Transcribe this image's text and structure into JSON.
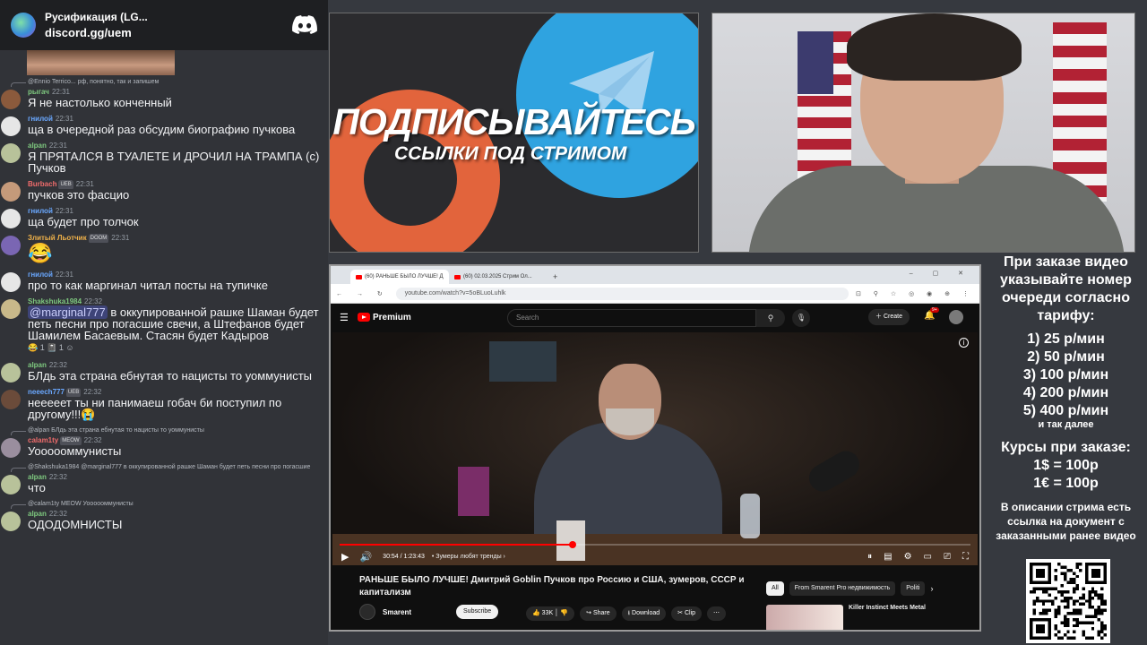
{
  "discord": {
    "server_name": "Русификация (LG...",
    "invite": "discord.gg/uem"
  },
  "chat": [
    {
      "type": "reply",
      "text": "@Ennio Terrico... рф, понятно, так и запишем"
    },
    {
      "type": "msg",
      "name": "рыгач",
      "name_color": "#7ec87f",
      "badge": "",
      "time": "22:31",
      "body": "Я не настолько конченный",
      "avatar_color": "#8b5a3c"
    },
    {
      "type": "msg",
      "name": "гнилой",
      "name_color": "#6aa8ff",
      "badge": "",
      "time": "22:31",
      "body": "ща в очередной раз обсудим биографию пучкова",
      "avatar_color": "#e6e6e6"
    },
    {
      "type": "msg",
      "name": "alpan",
      "name_color": "#7ec87f",
      "badge": "",
      "time": "22:31",
      "body": "Я ПРЯТАЛСЯ В ТУАЛЕТЕ И ДРОЧИЛ НА ТРАМПА (с) Пучков",
      "avatar_color": "#b8c29a"
    },
    {
      "type": "msg",
      "name": "Burbach",
      "name_color": "#f06c6c",
      "badge": "UEB",
      "time": "22:31",
      "body": "пучков это фасцио",
      "avatar_color": "#c59a7a"
    },
    {
      "type": "msg",
      "name": "гнилой",
      "name_color": "#6aa8ff",
      "badge": "",
      "time": "22:31",
      "body": "ща будет про толчок",
      "avatar_color": "#e6e6e6"
    },
    {
      "type": "msg",
      "name": "Злитый Льотчик",
      "name_color": "#f0b24a",
      "badge": "DOOM",
      "time": "22:31",
      "body": "😂",
      "avatar_color": "#7a66b3"
    },
    {
      "type": "msg",
      "name": "гнилой",
      "name_color": "#6aa8ff",
      "badge": "",
      "time": "22:31",
      "body": "про то как маргинал читал посты на тупичке",
      "avatar_color": "#e6e6e6"
    },
    {
      "type": "msg",
      "name": "Shakshuka1984",
      "name_color": "#7ec87f",
      "badge": "",
      "time": "22:32",
      "mention": "@marginal777",
      "body": " в оккупированной рашке Шаман будет петь песни про погасшие свечи, а Штефанов будет Шамилем Басаевым. Стасян будет Кадыров",
      "reactions": "😂 1   📓 1   ☺",
      "avatar_color": "#c9b98a"
    },
    {
      "type": "msg",
      "name": "alpan",
      "name_color": "#7ec87f",
      "badge": "",
      "time": "22:32",
      "body": "БЛдь эта страна ебнутая то нацисты то уоммунисты",
      "avatar_color": "#b8c29a"
    },
    {
      "type": "msg",
      "name": "neeech777",
      "name_color": "#6aa8ff",
      "badge": "UEB",
      "time": "22:32",
      "body": "нееееет ты ни панимаеш гобач би поступил по другому!!!😭",
      "avatar_color": "#6b4b3a"
    },
    {
      "type": "reply",
      "text": "@alpan БЛдь эта страна ебнутая то нацисты то уоммунисты"
    },
    {
      "type": "msg",
      "name": "calam1ty",
      "name_color": "#f06c6c",
      "badge": "MEOW",
      "time": "22:32",
      "body": "Уоооооммунисты",
      "avatar_color": "#9a8e9e"
    },
    {
      "type": "reply",
      "text": "@Shakshuka1984 @marginal777 в оккупированной рашке Шаман будет петь песни про погасшие"
    },
    {
      "type": "msg",
      "name": "alpan",
      "name_color": "#7ec87f",
      "badge": "",
      "time": "22:32",
      "body": "что",
      "avatar_color": "#b8c29a"
    },
    {
      "type": "reply",
      "text": "@calam1ty MEOW Уоооооммунисты"
    },
    {
      "type": "msg",
      "name": "alpan",
      "name_color": "#7ec87f",
      "badge": "",
      "time": "22:32",
      "body": "ОДОДОМНИСТЫ",
      "avatar_color": "#b8c29a"
    }
  ],
  "banner": {
    "line1": "ПОДПИСЫВАЙТЕСЬ",
    "line2": "ССЫЛКИ ПОД СТРИМОМ"
  },
  "browser": {
    "tab1": "(60) РАНЬШЕ БЫЛО ЛУЧШЕ! Д",
    "tab2": "(60) 02.03.2025 Стрим Ол...",
    "url": "youtube.com/watch?v=5oBLuoLuhlk"
  },
  "youtube": {
    "logo": "Premium",
    "search_placeholder": "Search",
    "create_label": "Create",
    "notif_count": "9+",
    "time": "30:54 / 1:23:43",
    "chapter": "• Зумеры любят тренды ›",
    "progress": 0.37,
    "title": "РАНЬШЕ БЫЛО ЛУЧШЕ! Дмитрий Goblin Пучков про Россию и США, зумеров, СССР и капитализм",
    "channel": "Smarent",
    "subscribe": "Subscribe",
    "likes": "33K",
    "share": "Share",
    "download": "Download",
    "clip": "Clip",
    "chips": [
      "All",
      "From Smarent Pro недвижимость",
      "Politi"
    ],
    "related_title": "Killer Instinct Meets Metal"
  },
  "info": {
    "p1": "При заказе видео указывайте номер очереди согласно тарифу:",
    "tariffs": [
      "1) 25 р/мин",
      "2) 50 р/мин",
      "3) 100 р/мин",
      "4) 200 р/мин",
      "5) 400 р/мин"
    ],
    "etc": "и так далее",
    "courses_title": "Курсы при заказе:",
    "courses": [
      "1$ = 100р",
      "1€ = 100р"
    ],
    "p3": "В описании стрима есть ссылка на документ с заказанными ранее видео"
  }
}
